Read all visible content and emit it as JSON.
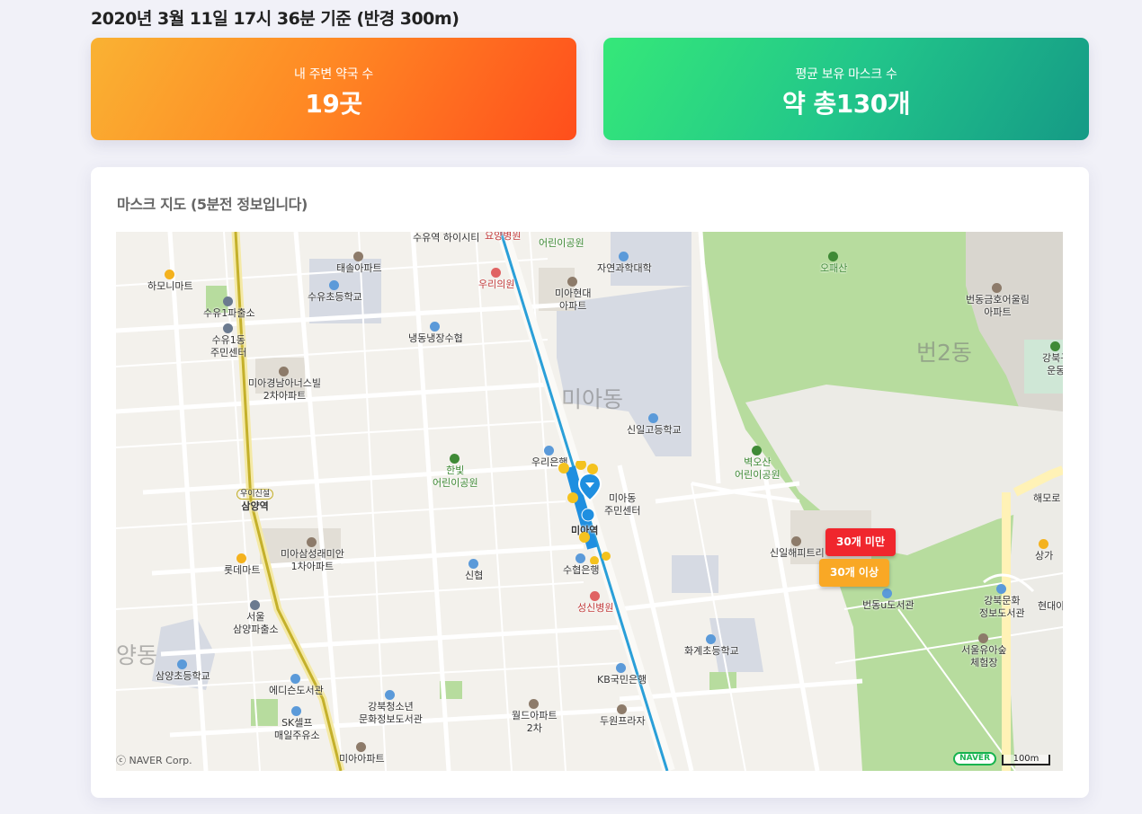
{
  "header": {
    "timestamp": "2020년 3월 11일 17시 36분 기준 (반경 300m)"
  },
  "cards": {
    "pharmacies": {
      "label": "내 주변 약국 수",
      "value": "19곳"
    },
    "masks": {
      "label": "평균 보유 마스크 수",
      "value": "약 총130개"
    }
  },
  "map": {
    "title": "마스크 지도 (5분전 정보입니다)",
    "copyright": "ⓒ NAVER Corp.",
    "logo": "NAVER",
    "scale": "100m",
    "legend": {
      "under": "30개 미만",
      "over": "30개 이상"
    },
    "districts": [
      "미아동",
      "번2동",
      "양동"
    ],
    "labels": [
      "태솔아파트",
      "수유역 하이시티",
      "요양병원",
      "어린이공원",
      "자연과학대학",
      "하모니마트",
      "수유초등학교",
      "우리의원",
      "미아현대 아파트",
      "오패산",
      "번동금호어울림 아파트",
      "수유1파출소",
      "수유1동 주민센터",
      "냉동냉장수협",
      "미아경남아너스빌 2차아파트",
      "신일고등학교",
      "강북구 운동",
      "벽오산 어린이공원",
      "한빛 어린이공원",
      "우리은행",
      "미아동 주민센터",
      "삼양역",
      "미아역",
      "해모로",
      "미아삼성래미안 1차아파트",
      "신일해피트리",
      "상가",
      "롯데마트",
      "신협",
      "수협은행",
      "번동u도서관",
      "서울 삼양파출소",
      "성신병원",
      "강북문화 정보도서관",
      "현대아",
      "화계초등학교",
      "서울유아숲 체험장",
      "삼양초등학교",
      "에디슨도서관",
      "KB국민은행",
      "강북청소년 문화정보도서관",
      "월드아파트 2차",
      "SK셀프 매일주유소",
      "두원프라자",
      "미아아파트",
      "우이신설"
    ]
  },
  "colors": {
    "orange_start": "#f9b233",
    "orange_end": "#ff4e1c",
    "green_start": "#35e879",
    "green_end": "#159a86",
    "badge_red": "#f0262d",
    "badge_yellow": "#f9a825"
  }
}
